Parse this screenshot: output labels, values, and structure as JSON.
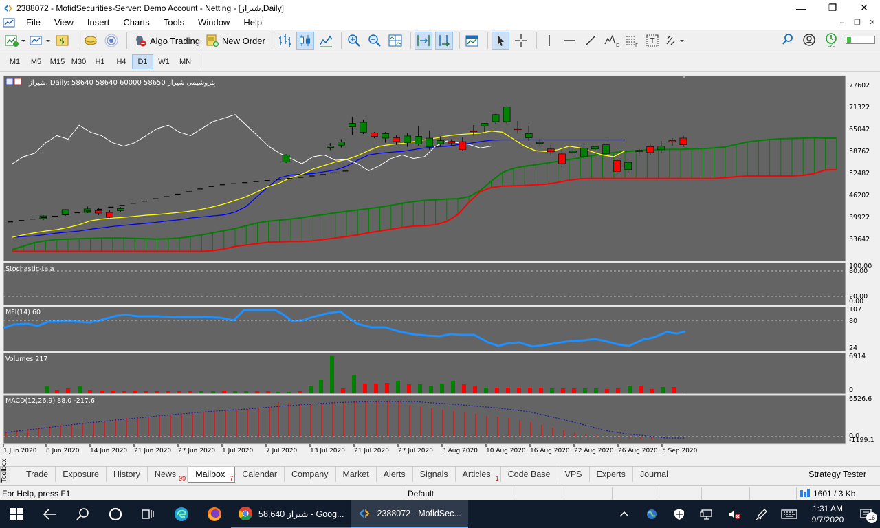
{
  "window": {
    "title": "2388072 - MofidSecurities-Server: Demo Account - Netting - [شیراز,Daily]",
    "controls": [
      "minimize",
      "maximize",
      "close"
    ]
  },
  "menu": [
    "File",
    "View",
    "Insert",
    "Charts",
    "Tools",
    "Window",
    "Help"
  ],
  "toolbar": {
    "algo_trading": "Algo Trading",
    "new_order": "New Order"
  },
  "timeframes": {
    "items": [
      "M1",
      "M5",
      "M15",
      "M30",
      "H1",
      "H4",
      "D1",
      "W1",
      "MN"
    ],
    "active": "D1"
  },
  "chart": {
    "header": "شیراز, Daily:  58640 58640 60000 58650  پتروشیمی شیراز",
    "price_ticks": [
      "77602",
      "71322",
      "65042",
      "58762",
      "52482",
      "46202",
      "39922",
      "33642"
    ],
    "date_ticks": [
      "1 Jun 2020",
      "8 Jun 2020",
      "14 Jun 2020",
      "21 Jun 2020",
      "27 Jun 2020",
      "1 Jul 2020",
      "7 Jul 2020",
      "13 Jul 2020",
      "21 Jul 2020",
      "27 Jul 2020",
      "3 Aug 2020",
      "10 Aug 2020",
      "16 Aug 2020",
      "22 Aug 2020",
      "26 Aug 2020",
      "5 Sep 2020"
    ],
    "stochastic": {
      "label": "Stochastic-tala",
      "ticks": [
        "100.00",
        "80.00",
        "20.00",
        "0.00"
      ]
    },
    "mfi": {
      "label": "MFI(14) 60",
      "ticks": [
        "107",
        "80",
        "24"
      ]
    },
    "volumes": {
      "label": "Volumes 217",
      "ticks": [
        "6914",
        "0"
      ]
    },
    "macd": {
      "label": "MACD(12,26,9) 88.0 -217.6",
      "ticks": [
        "6526.6",
        "0.0",
        "-1199.1"
      ]
    },
    "colors": {
      "background": "#646464",
      "bull": "#008000",
      "bear": "#ff0000",
      "tenkan": "#ffff00",
      "kijun": "#0000ff",
      "chikou": "#ffffff",
      "mfi": "#1e90ff"
    }
  },
  "tabs": {
    "toolbox": "Toolbox",
    "items": [
      {
        "label": "Trade",
        "count": ""
      },
      {
        "label": "Exposure",
        "count": ""
      },
      {
        "label": "History",
        "count": ""
      },
      {
        "label": "News",
        "count": "99"
      },
      {
        "label": "Mailbox",
        "count": "7"
      },
      {
        "label": "Calendar",
        "count": ""
      },
      {
        "label": "Company",
        "count": ""
      },
      {
        "label": "Market",
        "count": ""
      },
      {
        "label": "Alerts",
        "count": ""
      },
      {
        "label": "Signals",
        "count": ""
      },
      {
        "label": "Articles",
        "count": "1"
      },
      {
        "label": "Code Base",
        "count": ""
      },
      {
        "label": "VPS",
        "count": ""
      },
      {
        "label": "Experts",
        "count": ""
      },
      {
        "label": "Journal",
        "count": ""
      }
    ],
    "active": "Mailbox",
    "right": "Strategy Tester"
  },
  "status": {
    "help": "For Help, press F1",
    "profile": "Default",
    "traffic": "1601 / 3 Kb"
  },
  "taskbar": {
    "chrome_tab": "شیراز 58,640 - Goog...",
    "mt5_tab": "2388072 - MofidSec...",
    "time": "1:31 AM",
    "date": "9/7/2020",
    "notifications": "16"
  }
}
